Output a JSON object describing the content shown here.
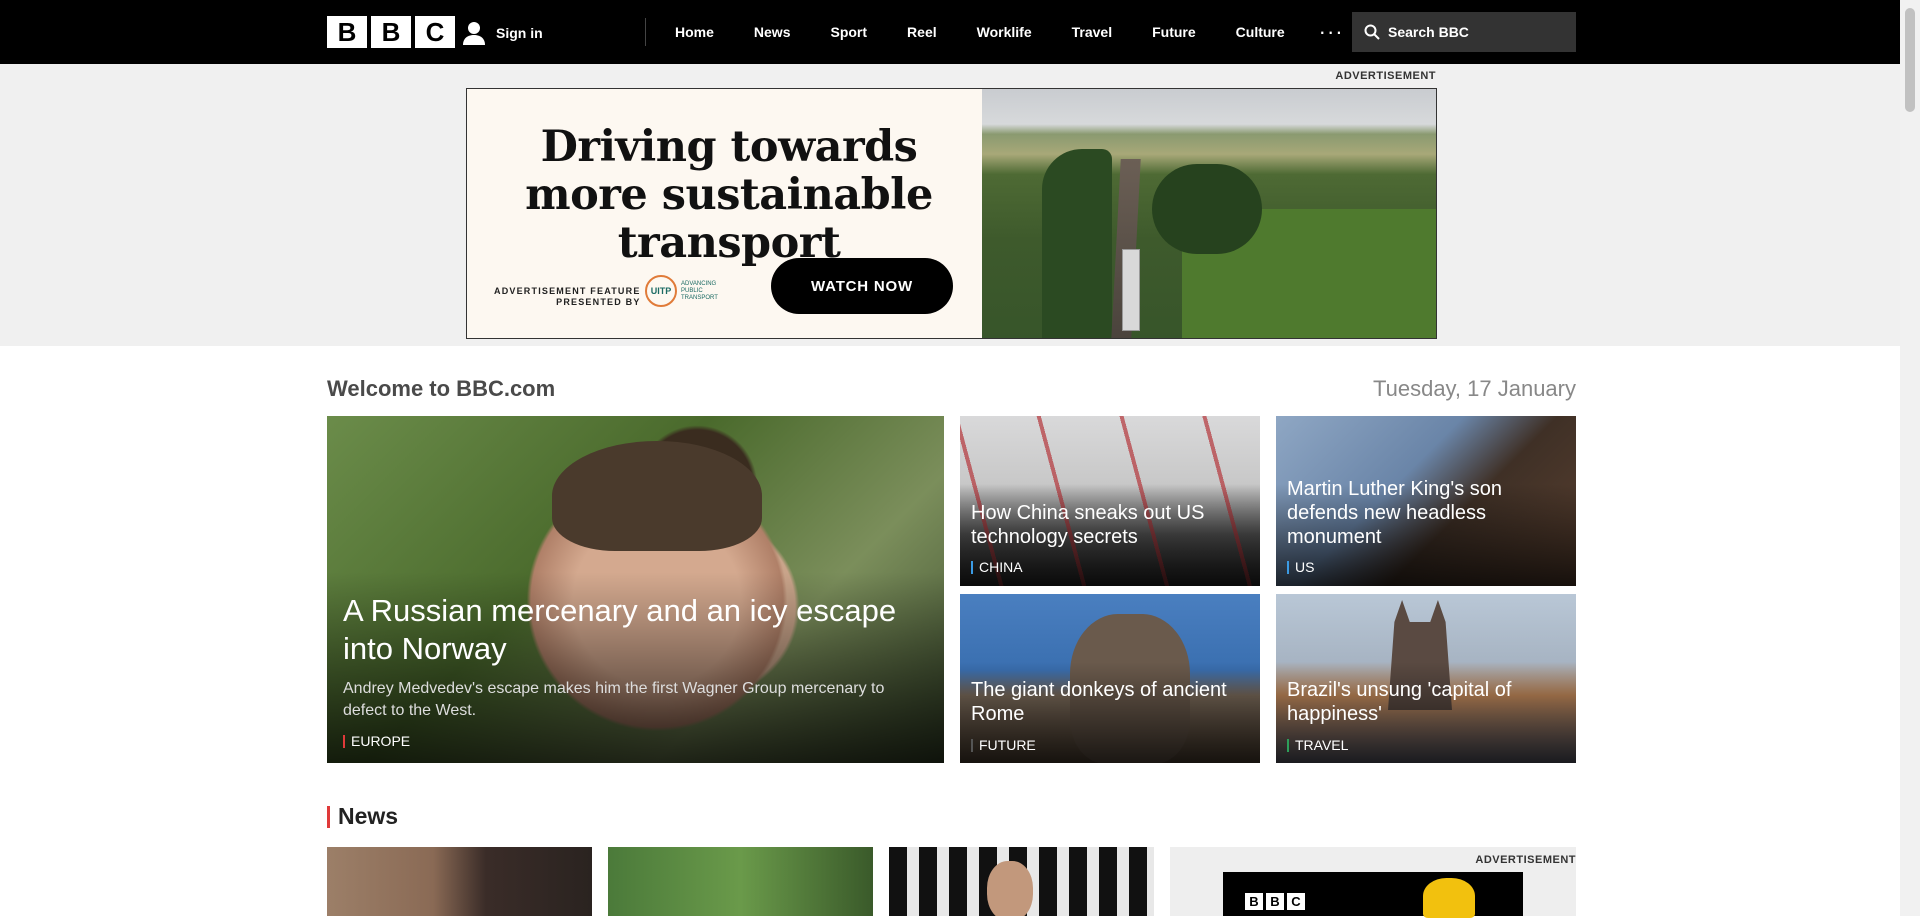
{
  "header": {
    "logo": [
      "B",
      "B",
      "C"
    ],
    "sign_in": "Sign in",
    "nav": [
      "Home",
      "News",
      "Sport",
      "Reel",
      "Worklife",
      "Travel",
      "Future",
      "Culture"
    ],
    "more": "···",
    "search_placeholder": "Search BBC"
  },
  "top_ad": {
    "label": "ADVERTISEMENT",
    "headline": "Driving towards more sustainable transport",
    "feature_line1": "ADVERTISEMENT FEATURE",
    "feature_line2": "PRESENTED BY",
    "sponsor_logo": "UITP",
    "sponsor_tagline": "ADVANCING PUBLIC TRANSPORT",
    "cta": "WATCH NOW"
  },
  "main": {
    "welcome": "Welcome to BBC.com",
    "date": "Tuesday, 17 January",
    "hero": {
      "title": "A Russian mercenary and an icy escape into Norway",
      "summary": "Andrey Medvedev's escape makes him the first Wagner Group mercenary to defect to the West.",
      "tag": "EUROPE"
    },
    "cards": [
      {
        "title": "How China sneaks out US technology secrets",
        "tag": "CHINA"
      },
      {
        "title": "Martin Luther King's son defends new headless monument",
        "tag": "US"
      },
      {
        "title": "The giant donkeys of ancient Rome",
        "tag": "FUTURE"
      },
      {
        "title": "Brazil's unsung 'capital of happiness'",
        "tag": "TRAVEL"
      }
    ]
  },
  "news": {
    "heading": "News",
    "ad_label": "ADVERTISEMENT",
    "ad_logo": [
      "B",
      "B",
      "C"
    ]
  }
}
